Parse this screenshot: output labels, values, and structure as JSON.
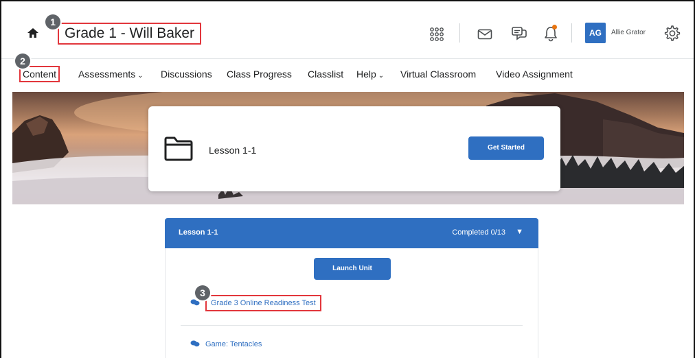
{
  "header": {
    "course_title": "Grade 1 - Will Baker",
    "user_initials": "AG",
    "user_name": "Allie Grator",
    "icons": [
      "home-icon",
      "waffle-grid-icon",
      "mail-icon",
      "chat-icon",
      "bell-icon",
      "gear-icon"
    ],
    "notification_color": "#e87511"
  },
  "callouts": [
    "1",
    "2",
    "3"
  ],
  "nav": {
    "items": [
      {
        "label": "Content",
        "active": true
      },
      {
        "label": "Assessments",
        "dropdown": true
      },
      {
        "label": "Discussions"
      },
      {
        "label": "Class Progress"
      },
      {
        "label": "Classlist"
      },
      {
        "label": "Help",
        "dropdown": true
      },
      {
        "label": "Virtual Classroom"
      },
      {
        "label": "Video Assignment"
      }
    ]
  },
  "banner": {
    "title": "Lesson 1-1",
    "button_label": "Get Started"
  },
  "unit": {
    "title": "Lesson 1-1",
    "progress": "Completed 0/13",
    "launch_label": "Launch Unit",
    "activities": [
      {
        "label": "Grade 3 Online Readiness Test",
        "highlighted": true
      },
      {
        "label": "Game: Tentacles"
      }
    ]
  },
  "colors": {
    "accent": "#2f6fc1",
    "highlight": "#e2363c"
  }
}
